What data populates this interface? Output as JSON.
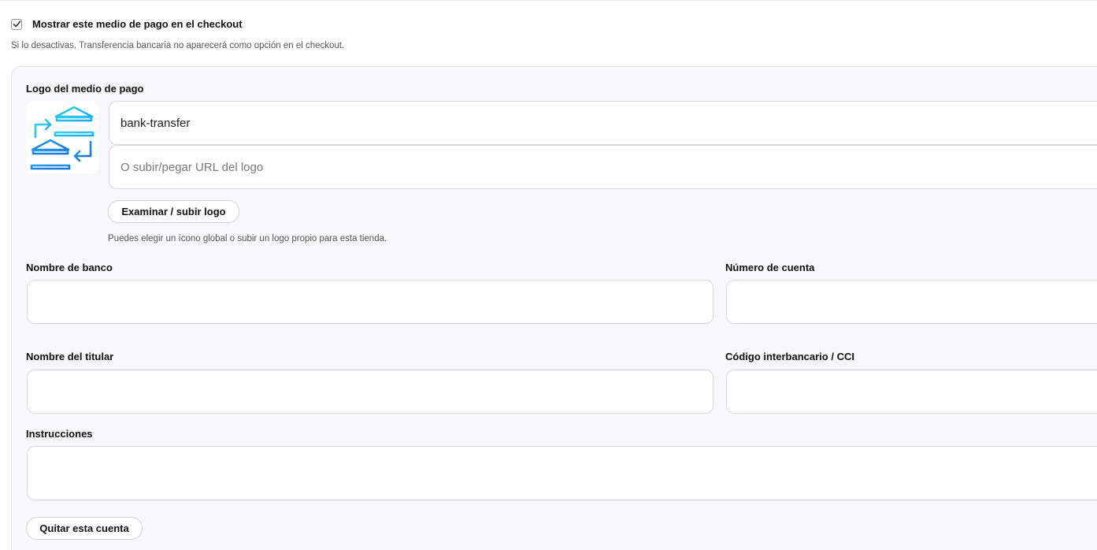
{
  "visibility": {
    "checked": true,
    "label": "Mostrar este medio de pago en el checkout",
    "hint": "Si lo desactivas, Transferencia bancaria no aparecerá como opción en el checkout."
  },
  "logo": {
    "label": "Logo del medio de pago",
    "icon_value": "bank-transfer",
    "url_placeholder": "O subir/pegar URL del logo",
    "browse_button": "Examinar / subir logo",
    "hint": "Puedes elegir un ícono global o subir un logo propio para esta tienda.",
    "icon": "bank-transfer-icon"
  },
  "fields": {
    "bank_name": {
      "label": "Nombre de banco",
      "value": ""
    },
    "account_number": {
      "label": "Número de cuenta",
      "value": ""
    },
    "holder_name": {
      "label": "Nombre del titular",
      "value": ""
    },
    "cci": {
      "label": "Código interbancario / CCI",
      "value": ""
    },
    "instructions": {
      "label": "Instrucciones",
      "value": ""
    }
  },
  "remove_button": "Quitar esta cuenta",
  "colors": {
    "accent_light": "#22c3f0",
    "accent_dark": "#1d7de0"
  }
}
